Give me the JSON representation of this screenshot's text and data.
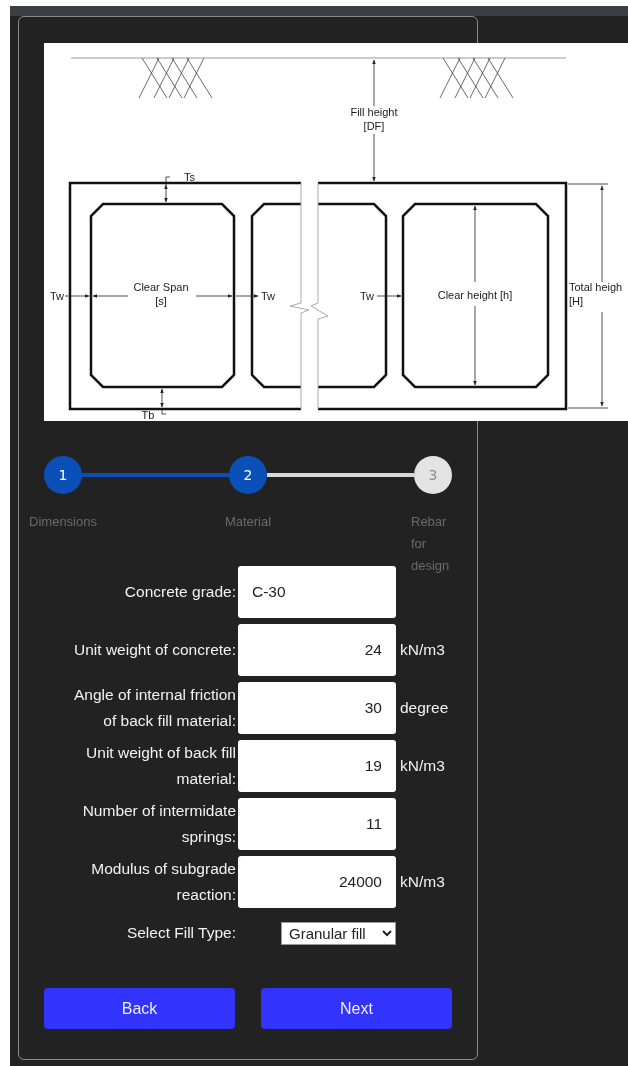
{
  "diagram": {
    "labels": [
      {
        "lines": [
          "Fill height",
          "[DF]"
        ]
      },
      {
        "lines": [
          "Ts"
        ]
      },
      {
        "lines": [
          "Tw"
        ]
      },
      {
        "lines": [
          "Clear Span",
          "[s]"
        ]
      },
      {
        "lines": [
          "Tw"
        ]
      },
      {
        "lines": [
          "Tw"
        ]
      },
      {
        "lines": [
          "Clear height [h]"
        ]
      },
      {
        "lines": [
          "Total heigh",
          "[H]"
        ]
      },
      {
        "lines": [
          "Tb"
        ]
      }
    ]
  },
  "stepper": [
    {
      "number": "1",
      "label": "Dimensions",
      "active": true
    },
    {
      "number": "2",
      "label": "Material",
      "active": true
    },
    {
      "number": "3",
      "label": "Rebar for design",
      "active": false
    }
  ],
  "fields": [
    {
      "label": "Concrete grade:",
      "value": "C-30",
      "kind": "text"
    },
    {
      "label": "Unit weight of concrete:",
      "value": "24",
      "unit": "kN/m3",
      "kind": "number"
    },
    {
      "label": "Angle of internal friction of back fill material:",
      "value": "30",
      "unit": "degree",
      "kind": "number"
    },
    {
      "label": "Unit weight of back fill material:",
      "value": "19",
      "unit": "kN/m3",
      "kind": "number"
    },
    {
      "label": "Number of intermidate springs:",
      "value": "11",
      "kind": "number"
    },
    {
      "label": "Modulus of subgrade reaction:",
      "value": "24000",
      "unit": "kN/m3",
      "kind": "number"
    }
  ],
  "fill_type": {
    "label": "Select Fill Type:",
    "value": "Granular fill"
  },
  "buttons": [
    "Back",
    "Next"
  ]
}
